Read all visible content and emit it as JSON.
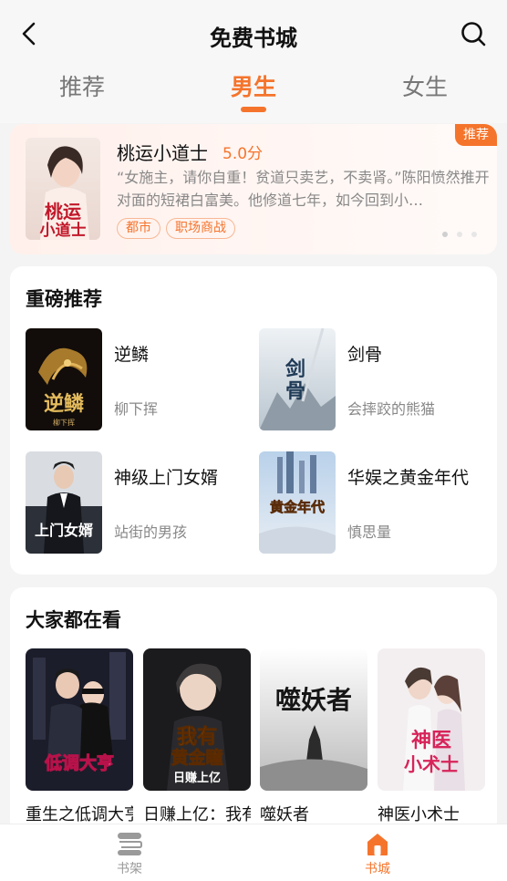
{
  "header": {
    "title": "免费书城"
  },
  "tabs": [
    {
      "label": "推荐",
      "active": false
    },
    {
      "label": "男生",
      "active": true
    },
    {
      "label": "女生",
      "active": false
    }
  ],
  "banner": {
    "badge": "推荐",
    "title": "桃运小道士",
    "score": "5.0分",
    "description": "“女施主，请你自重！贫道只卖艺，不卖肾。”陈阳愤然推开对面的短裙白富美。他修道七年，如今回到小…",
    "tags": [
      "都市",
      "职场商战"
    ],
    "cover_text": "桃运小道士",
    "slide_count": 3,
    "active_slide": 1
  },
  "featured": {
    "title": "重磅推荐",
    "books": [
      {
        "name": "逆鳞",
        "author": "柳下挥",
        "cover_text": "逆鳞"
      },
      {
        "name": "剑骨",
        "author": "会摔跤的熊猫",
        "cover_text": "剑骨"
      },
      {
        "name": "神级上门女婿",
        "author": "站街的男孩",
        "cover_text": "上门女婿"
      },
      {
        "name": "华娱之黄金年代",
        "author": "慎思量",
        "cover_text": "黄金年代"
      }
    ]
  },
  "popular": {
    "title": "大家都在看",
    "books": [
      {
        "name": "重生之低调大亨",
        "cover_text": "低调大亨"
      },
      {
        "name": "日赚上亿：我有黄金瞳",
        "cover_text": "我有黄金瞳"
      },
      {
        "name": "噬妖者",
        "cover_text": "噬妖者"
      },
      {
        "name": "神医小术士",
        "cover_text": "神医小术士"
      }
    ]
  },
  "bottom_nav": [
    {
      "label": "书架",
      "icon": "bookshelf-icon",
      "active": false
    },
    {
      "label": "书城",
      "icon": "store-home-icon",
      "active": true
    }
  ],
  "colors": {
    "accent": "#f5742c",
    "muted": "#888888"
  }
}
